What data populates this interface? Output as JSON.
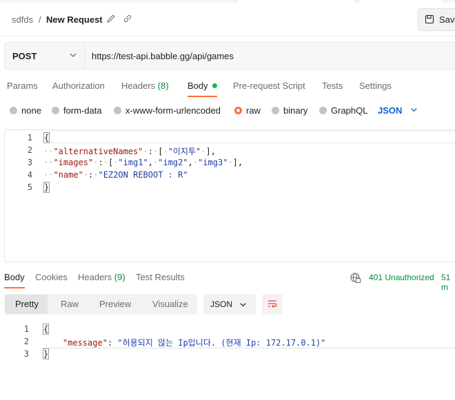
{
  "header": {
    "workspace": "sdfds",
    "separator": "/",
    "title": "New Request",
    "save_label": "Save"
  },
  "request": {
    "method": "POST",
    "url": "https://test-api.babble.gg/api/games"
  },
  "request_tabs": {
    "params": "Params",
    "authorization": "Authorization",
    "headers": "Headers",
    "headers_count": "(8)",
    "body": "Body",
    "pre_request": "Pre-request Script",
    "tests": "Tests",
    "settings": "Settings"
  },
  "body_types": {
    "none": "none",
    "form_data": "form-data",
    "urlencoded": "x-www-form-urlencoded",
    "raw": "raw",
    "binary": "binary",
    "graphql": "GraphQL",
    "format": "JSON",
    "selected": "raw"
  },
  "request_body": {
    "line_numbers": [
      "1",
      "2",
      "3",
      "4",
      "5"
    ],
    "open_brace": "{",
    "close_brace": "}",
    "key_alt": "\"alternativeNames\"",
    "val_alt": "\"이지투\"",
    "key_images": "\"images\"",
    "val_img1": "\"img1\"",
    "val_img2": "\"img2\"",
    "val_img3": "\"img3\"",
    "key_name": "\"name\"",
    "val_name": "\"EZ2ON REBOOT : R\""
  },
  "response_tabs": {
    "body": "Body",
    "cookies": "Cookies",
    "headers": "Headers",
    "headers_count": "(9)",
    "test_results": "Test Results"
  },
  "response_meta": {
    "status": "401 Unauthorized",
    "time": "51 m"
  },
  "view_modes": {
    "pretty": "Pretty",
    "raw": "Raw",
    "preview": "Preview",
    "visualize": "Visualize",
    "format": "JSON"
  },
  "response_body": {
    "line_numbers": [
      "1",
      "2",
      "3"
    ],
    "open_brace": "{",
    "close_brace": "}",
    "key_message": "\"message\"",
    "val_message": "\"허용되지 않는 Ip입니다. (현재 Ip: 172.17.0.1)\""
  },
  "colors": {
    "accent": "#ff6c37",
    "success": "#0a8a3a",
    "link": "#0b5fd0"
  }
}
